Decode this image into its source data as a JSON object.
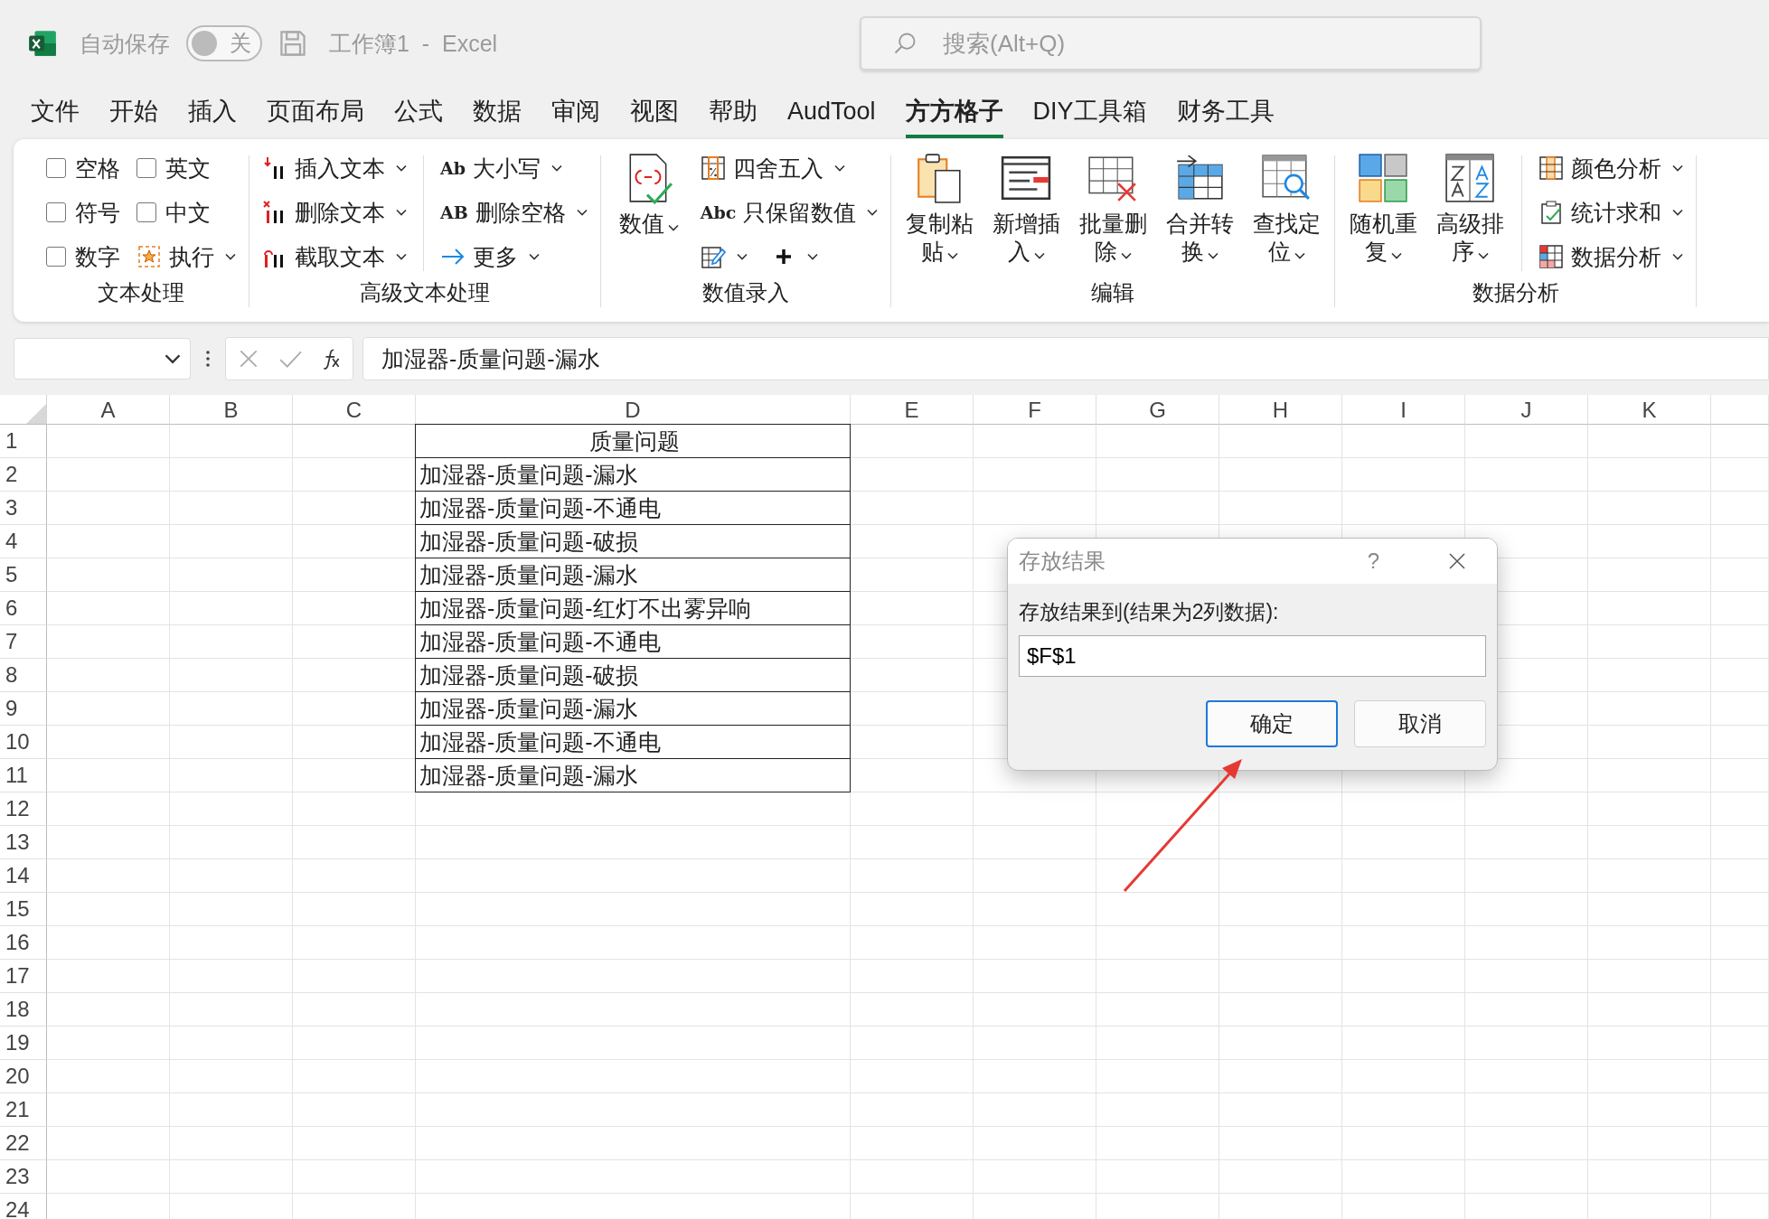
{
  "title_bar": {
    "autosave": {
      "label": "自动保存",
      "toggle_text": "关",
      "on": false
    },
    "document_title": "工作簿1  -  Excel",
    "search": {
      "placeholder": "搜索(Alt+Q)"
    }
  },
  "menu_tabs": [
    {
      "label": "文件",
      "selected": false
    },
    {
      "label": "开始",
      "selected": false
    },
    {
      "label": "插入",
      "selected": false
    },
    {
      "label": "页面布局",
      "selected": false
    },
    {
      "label": "公式",
      "selected": false
    },
    {
      "label": "数据",
      "selected": false
    },
    {
      "label": "审阅",
      "selected": false
    },
    {
      "label": "视图",
      "selected": false
    },
    {
      "label": "帮助",
      "selected": false
    },
    {
      "label": "AudTool",
      "selected": false
    },
    {
      "label": "方方格子",
      "selected": true
    },
    {
      "label": "DIY工具箱",
      "selected": false
    },
    {
      "label": "财务工具",
      "selected": false
    }
  ],
  "ribbon": {
    "groups": [
      {
        "label": "文本处理",
        "columns": [
          {
            "kind": "items",
            "items": [
              {
                "kind": "checkbox",
                "label": "空格",
                "checked": false
              },
              {
                "kind": "checkbox",
                "label": "符号",
                "checked": false
              },
              {
                "kind": "checkbox",
                "label": "数字",
                "checked": false
              }
            ]
          },
          {
            "kind": "items",
            "items": [
              {
                "kind": "checkbox",
                "label": "英文",
                "checked": false
              },
              {
                "kind": "checkbox",
                "label": "中文",
                "checked": false
              },
              {
                "kind": "small",
                "label": "执行",
                "dropdown": true
              }
            ]
          }
        ]
      },
      {
        "label": "高级文本处理",
        "columns": [
          {
            "kind": "items",
            "items": [
              {
                "kind": "small",
                "label": "插入文本",
                "dropdown": true
              },
              {
                "kind": "small",
                "label": "删除文本",
                "dropdown": true
              },
              {
                "kind": "small",
                "label": "截取文本",
                "dropdown": true
              }
            ]
          },
          {
            "kind": "separator"
          },
          {
            "kind": "items",
            "items": [
              {
                "kind": "small",
                "glyph": "Ab",
                "label": "大小写",
                "dropdown": true
              },
              {
                "kind": "small",
                "glyph": "AB",
                "label": "删除空格",
                "dropdown": true
              },
              {
                "kind": "small",
                "label": "更多",
                "dropdown": true
              }
            ]
          }
        ]
      },
      {
        "label": "数值录入",
        "columns": [
          {
            "kind": "items",
            "items": [
              {
                "kind": "large",
                "label": "数值",
                "dropdown": true
              }
            ]
          },
          {
            "kind": "items",
            "items": [
              {
                "kind": "small",
                "label": "四舍五入",
                "dropdown": true
              },
              {
                "kind": "small",
                "glyph": "Abc",
                "label": "只保留数值",
                "dropdown": true
              },
              {
                "kind": "icons",
                "items": [
                  {
                    "dropdown": true
                  },
                  {
                    "dropdown": true
                  }
                ]
              }
            ]
          }
        ]
      },
      {
        "label": "编辑",
        "columns": [
          {
            "kind": "items",
            "items": [
              {
                "kind": "large",
                "label": "复制粘贴",
                "dropdown": true
              }
            ]
          },
          {
            "kind": "items",
            "items": [
              {
                "kind": "large",
                "label": "新增插入",
                "dropdown": true
              }
            ]
          },
          {
            "kind": "items",
            "items": [
              {
                "kind": "large",
                "label": "批量删除",
                "dropdown": true
              }
            ]
          },
          {
            "kind": "items",
            "items": [
              {
                "kind": "large",
                "label": "合并转换",
                "dropdown": true
              }
            ]
          },
          {
            "kind": "items",
            "items": [
              {
                "kind": "large",
                "label": "查找定位",
                "dropdown": true
              }
            ]
          }
        ]
      },
      {
        "label": "数据分析",
        "columns": [
          {
            "kind": "items",
            "items": [
              {
                "kind": "large",
                "label": "随机重复",
                "dropdown": true
              }
            ]
          },
          {
            "kind": "items",
            "items": [
              {
                "kind": "large",
                "label": "高级排序",
                "dropdown": true
              }
            ]
          },
          {
            "kind": "separator"
          },
          {
            "kind": "items",
            "items": [
              {
                "kind": "small",
                "label": "颜色分析",
                "dropdown": true
              },
              {
                "kind": "small",
                "label": "统计求和",
                "dropdown": true
              },
              {
                "kind": "small",
                "label": "数据分析",
                "dropdown": true
              }
            ]
          }
        ]
      }
    ]
  },
  "formula_bar": {
    "formula": "加湿器-质量问题-漏水"
  },
  "sheet": {
    "row_numbers": [
      "1",
      "2",
      "3",
      "4",
      "5",
      "6",
      "7",
      "8",
      "9",
      "10",
      "11",
      "12",
      "13",
      "14",
      "15",
      "16",
      "17",
      "18",
      "19",
      "20",
      "21",
      "22",
      "23",
      "24"
    ],
    "columns": [
      {
        "letter": "A"
      },
      {
        "letter": "B"
      },
      {
        "letter": "C"
      },
      {
        "letter": "D",
        "header": "质量问题",
        "values": [
          "加湿器-质量问题-漏水",
          "加湿器-质量问题-不通电",
          "加湿器-质量问题-破损",
          "加湿器-质量问题-漏水",
          "加湿器-质量问题-红灯不出雾异响",
          "加湿器-质量问题-不通电",
          "加湿器-质量问题-破损",
          "加湿器-质量问题-漏水",
          "加湿器-质量问题-不通电",
          "加湿器-质量问题-漏水"
        ]
      },
      {
        "letter": "E"
      },
      {
        "letter": "F"
      },
      {
        "letter": "G"
      },
      {
        "letter": "H"
      },
      {
        "letter": "I"
      },
      {
        "letter": "J"
      },
      {
        "letter": "K"
      }
    ]
  },
  "dialog": {
    "title": "存放结果",
    "help": "?",
    "prompt": "存放结果到(结果为2列数据):",
    "value": "$F$1",
    "buttons": [
      {
        "label": "确定",
        "focused": true
      },
      {
        "label": "取消",
        "focused": false
      }
    ]
  }
}
